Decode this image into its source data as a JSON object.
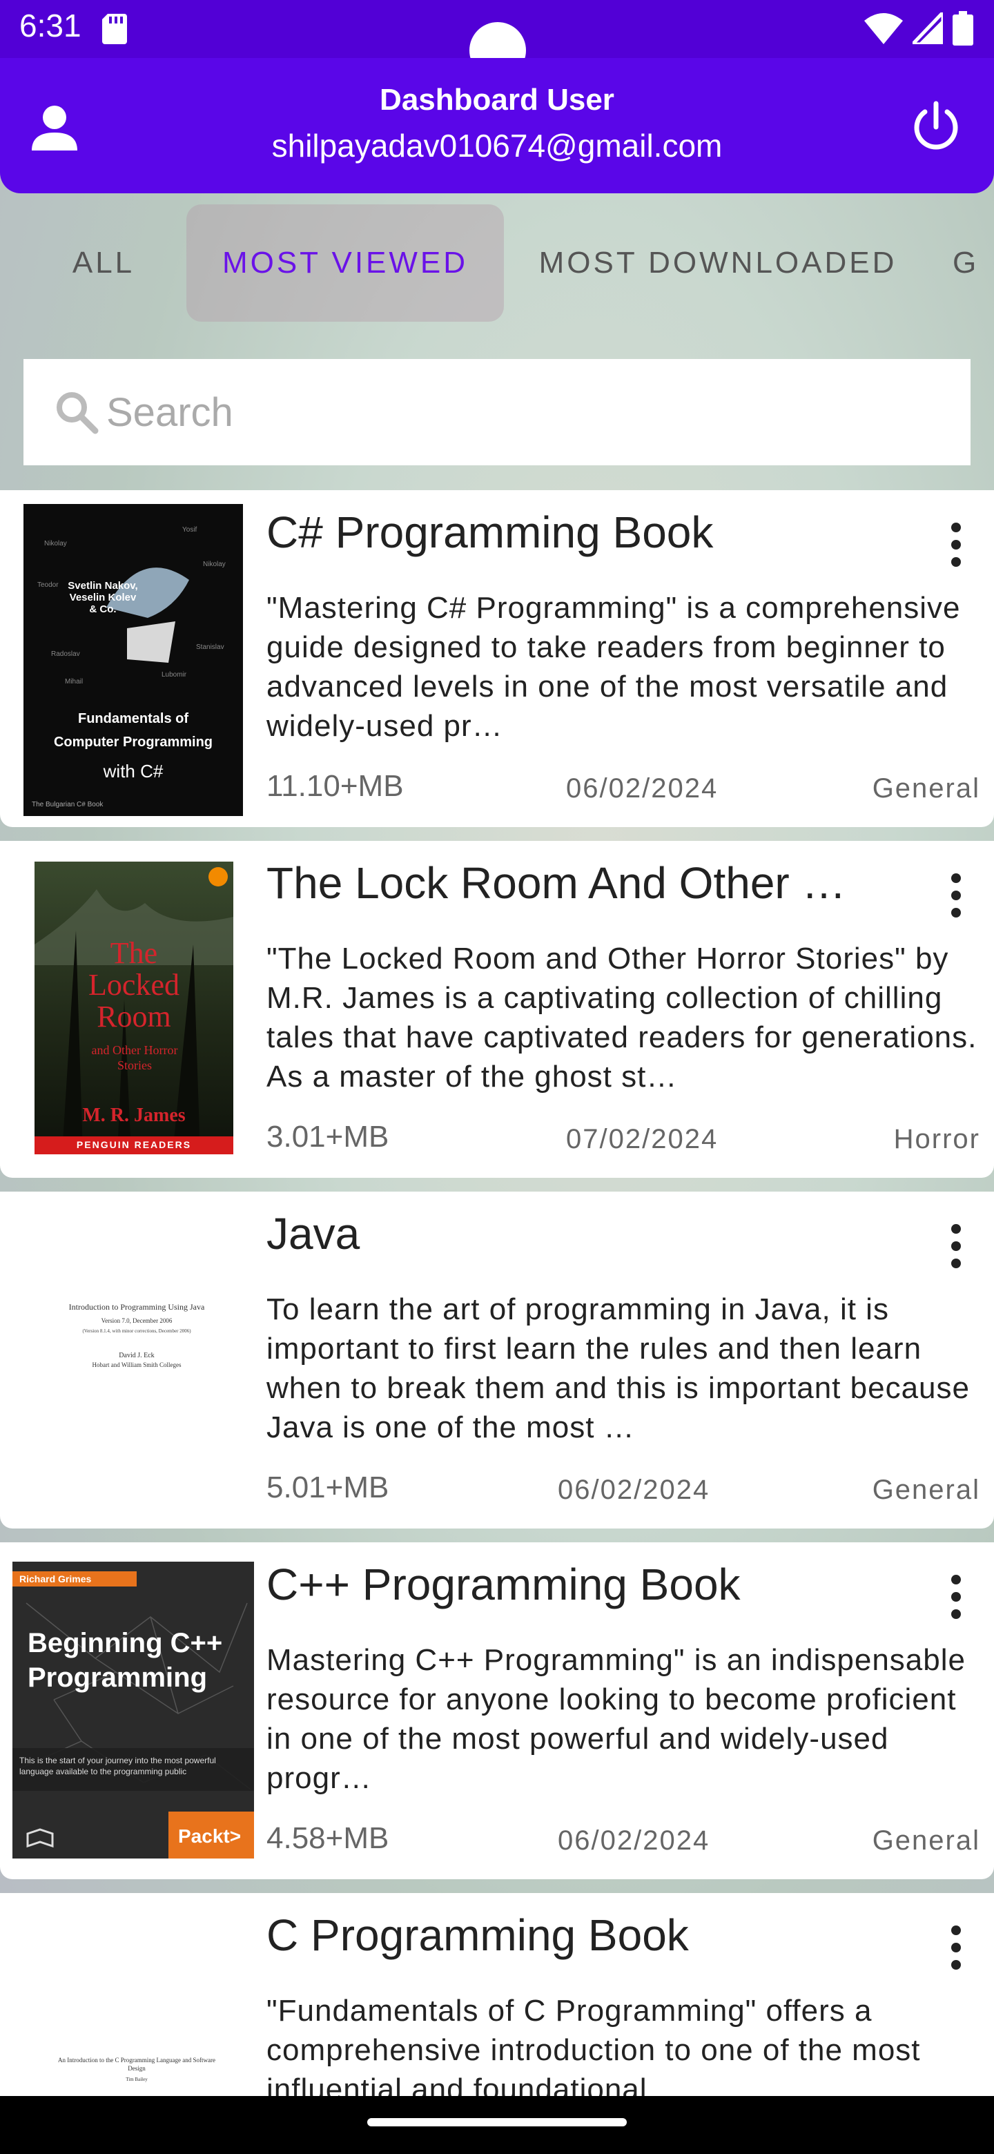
{
  "status_bar": {
    "time": "6:31"
  },
  "header": {
    "title": "Dashboard User",
    "email": "shilpayadav010674@gmail.com",
    "accent": "#5a06e8"
  },
  "tabs": [
    {
      "label": "ALL",
      "active": false
    },
    {
      "label": "MOST VIEWED",
      "active": true
    },
    {
      "label": "MOST DOWNLOADED",
      "active": false
    },
    {
      "label": "G",
      "active": false
    }
  ],
  "search": {
    "placeholder": "Search"
  },
  "books": [
    {
      "title": "C# Programming Book",
      "description": "\"Mastering C# Programming\" is a comprehensive guide designed to take readers from beginner to advanced levels in one of the most versatile and widely-used pr…",
      "size": "11.10+MB",
      "date": "06/02/2024",
      "category": "General",
      "cover": {
        "authors": "Svetlin Nakov, Veselin Kolev & Co.",
        "title_line1": "Fundamentals of",
        "title_line2": "Computer Programming",
        "title_line3": "with C#",
        "footer": "The Bulgarian C# Book"
      }
    },
    {
      "title": "The Lock Room And Other …",
      "description": "\"The Locked Room and Other Horror Stories\" by M.R. James is a captivating collection of chilling tales that have captivated readers for generations. As a master of the ghost st…",
      "size": "3.01+MB",
      "date": "07/02/2024",
      "category": "Horror",
      "cover": {
        "title_line1": "The",
        "title_line2": "Locked",
        "title_line3": "Room",
        "subtitle": "and Other Horror Stories",
        "author": "M. R. James",
        "footer": "PENGUIN READERS"
      }
    },
    {
      "title": "Java",
      "description": "To learn the art of programming in Java, it is important to first learn the rules and then learn when to break them and this is important because Java is one of the most …",
      "size": "5.01+MB",
      "date": "06/02/2024",
      "category": "General",
      "cover": {
        "line1": "Introduction to Programming Using Java",
        "line2": "Version 7.0, December 2006",
        "line3": "(Version 8.1.4, with minor corrections, December 2006)",
        "line4": "David J. Eck",
        "line5": "Hobart and William Smith Colleges"
      }
    },
    {
      "title": "C++ Programming Book",
      "description": "Mastering C++ Programming\" is an indispensable resource for anyone looking to become proficient in one of the most powerful and widely-used progr…",
      "size": "4.58+MB",
      "date": "06/02/2024",
      "category": "General",
      "cover": {
        "author": "Richard Grimes",
        "title_line1": "Beginning C++",
        "title_line2": "Programming",
        "blurb": "This is the start of your journey into the most powerful language available to the programming public",
        "publisher": "Packt>"
      }
    },
    {
      "title": "C Programming Book",
      "description": "\"Fundamentals of C Programming\" offers a comprehensive introduction to one of the most influential and foundational",
      "size": "",
      "date": "",
      "category": "",
      "cover": {
        "line1": "An Introduction to the C Programming Language and Software Design",
        "line2": "Tim Bailey"
      }
    }
  ]
}
